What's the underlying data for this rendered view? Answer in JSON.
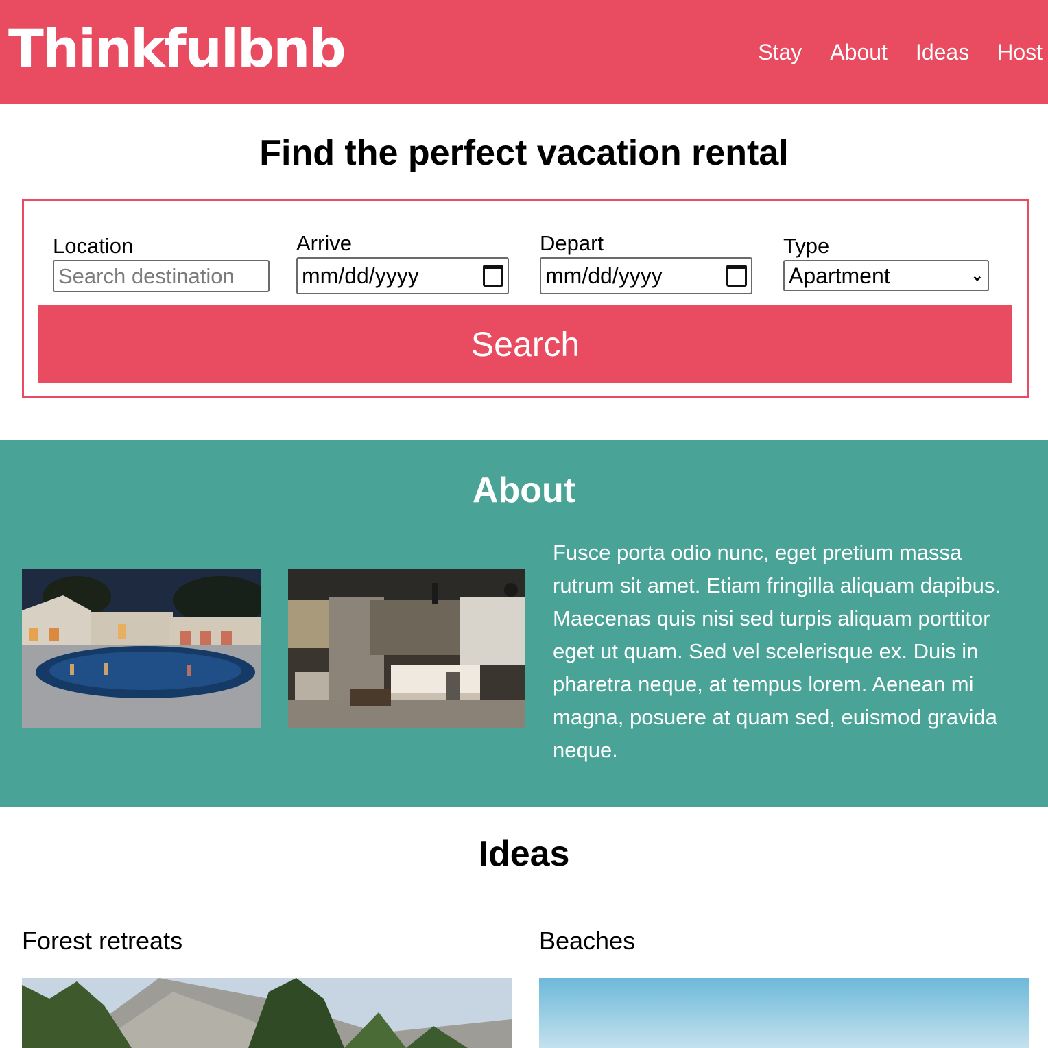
{
  "header": {
    "logo": "Thinkfulbnb",
    "nav": [
      "Stay",
      "About",
      "Ideas",
      "Host"
    ]
  },
  "search": {
    "title": "Find the perfect vacation rental",
    "location_label": "Location",
    "location_placeholder": "Search destination",
    "arrive_label": "Arrive",
    "arrive_value": "mm/dd/yyyy",
    "depart_label": "Depart",
    "depart_value": "mm/dd/yyyy",
    "type_label": "Type",
    "type_value": "Apartment",
    "button_label": "Search"
  },
  "about": {
    "title": "About",
    "text": "Fusce porta odio nunc, eget pretium massa rutrum sit amet. Etiam fringilla aliquam dapibus. Maecenas quis nisi sed turpis aliquam porttitor eget ut quam. Sed vel scelerisque ex. Duis in pharetra neque, at tempus lorem. Aenean mi magna, posuere at quam sed, euismod gravida neque."
  },
  "ideas": {
    "title": "Ideas",
    "items": [
      {
        "label": "Forest retreats"
      },
      {
        "label": "Beaches"
      }
    ]
  },
  "colors": {
    "brand": "#e94b61",
    "about_bg": "#49a396",
    "text": "#000000"
  }
}
